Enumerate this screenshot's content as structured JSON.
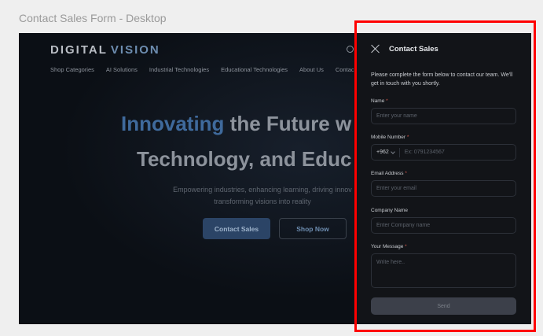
{
  "frame_title": "Contact Sales Form - Desktop",
  "site": {
    "logo_main": "DIGITAL",
    "logo_accent": "VISION",
    "nav": [
      "Shop Categories",
      "AI Solutions",
      "Industrial Technologies",
      "Educational Technologies",
      "About Us",
      "Contact U"
    ],
    "hero_line1_accent": "Innovating",
    "hero_line1_rest": " the Future w",
    "hero_line2": "Technology, and Educ",
    "hero_sub": "Empowering industries, enhancing learning, driving innov transforming visions into reality",
    "primary_button": "Contact Sales",
    "secondary_button": "Shop Now"
  },
  "panel": {
    "title": "Contact Sales",
    "intro": "Please complete the form below to contact our team. We'll get in touch with you shortly.",
    "required_mark": "*",
    "fields": {
      "name_label": "Name",
      "name_placeholder": "Enter your name",
      "mobile_label": "Mobile Number",
      "country_code": "+962",
      "mobile_placeholder": "Ex: 0791234567",
      "email_label": "Email Address",
      "email_placeholder": "Enter your email",
      "company_label": "Company Name",
      "company_placeholder": "Enter Company name",
      "message_label": "Your Message",
      "message_placeholder": "Write here.."
    },
    "send_label": "Send"
  },
  "colors": {
    "highlight_border": "#ff0000",
    "panel_bg": "#121418",
    "accent_blue": "#3f6a9c",
    "required": "#d1564b"
  }
}
